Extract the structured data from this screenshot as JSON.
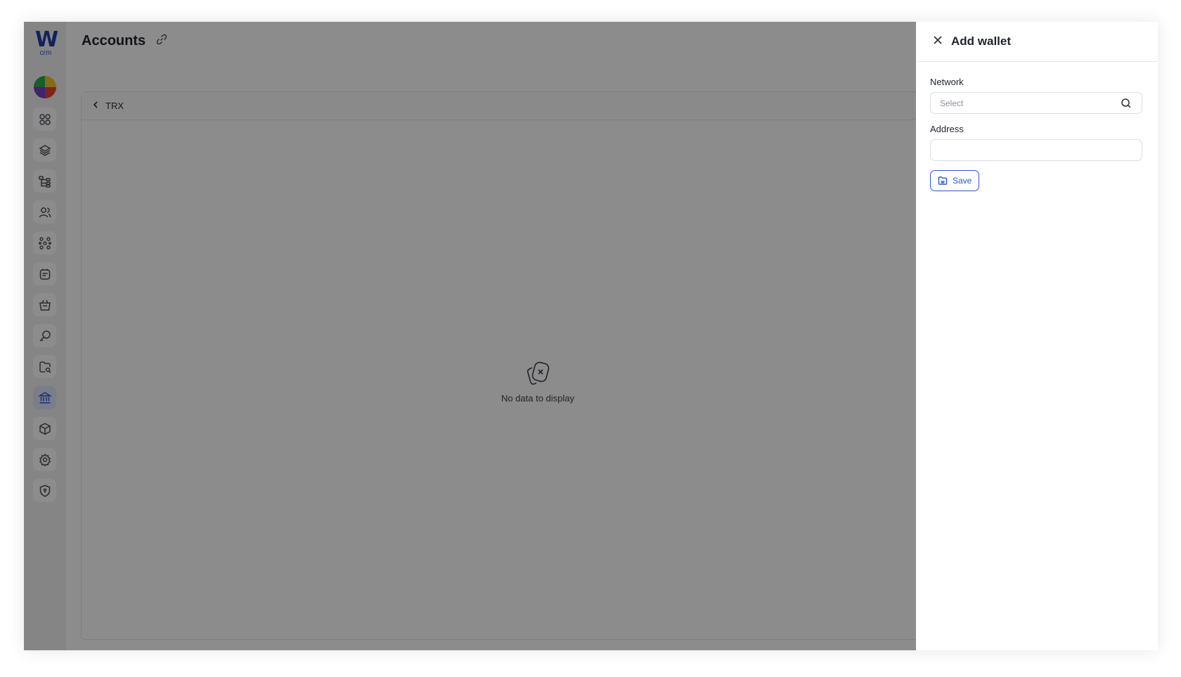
{
  "app": {
    "logo_letter": "W",
    "logo_sub": "crm"
  },
  "sidebar": {
    "items": [
      {
        "icon": "dashboard-icon"
      },
      {
        "icon": "layers-icon"
      },
      {
        "icon": "hierarchy-icon"
      },
      {
        "icon": "users-icon"
      },
      {
        "icon": "network-icon"
      },
      {
        "icon": "notes-icon"
      },
      {
        "icon": "basket-icon"
      },
      {
        "icon": "key-icon"
      },
      {
        "icon": "folder-search-icon"
      },
      {
        "icon": "bank-icon",
        "active": true
      },
      {
        "icon": "cube-icon"
      },
      {
        "icon": "gear-icon"
      },
      {
        "icon": "shield-icon"
      }
    ]
  },
  "page": {
    "title": "Accounts"
  },
  "card": {
    "back_label": "TRX",
    "empty_text": "No data to display"
  },
  "drawer": {
    "title": "Add wallet",
    "network_label": "Network",
    "network_placeholder": "Select",
    "address_label": "Address",
    "address_value": "",
    "save_label": "Save"
  },
  "colors": {
    "accent": "#2b56d6",
    "overlay": "rgba(0,0,0,0.45)"
  }
}
